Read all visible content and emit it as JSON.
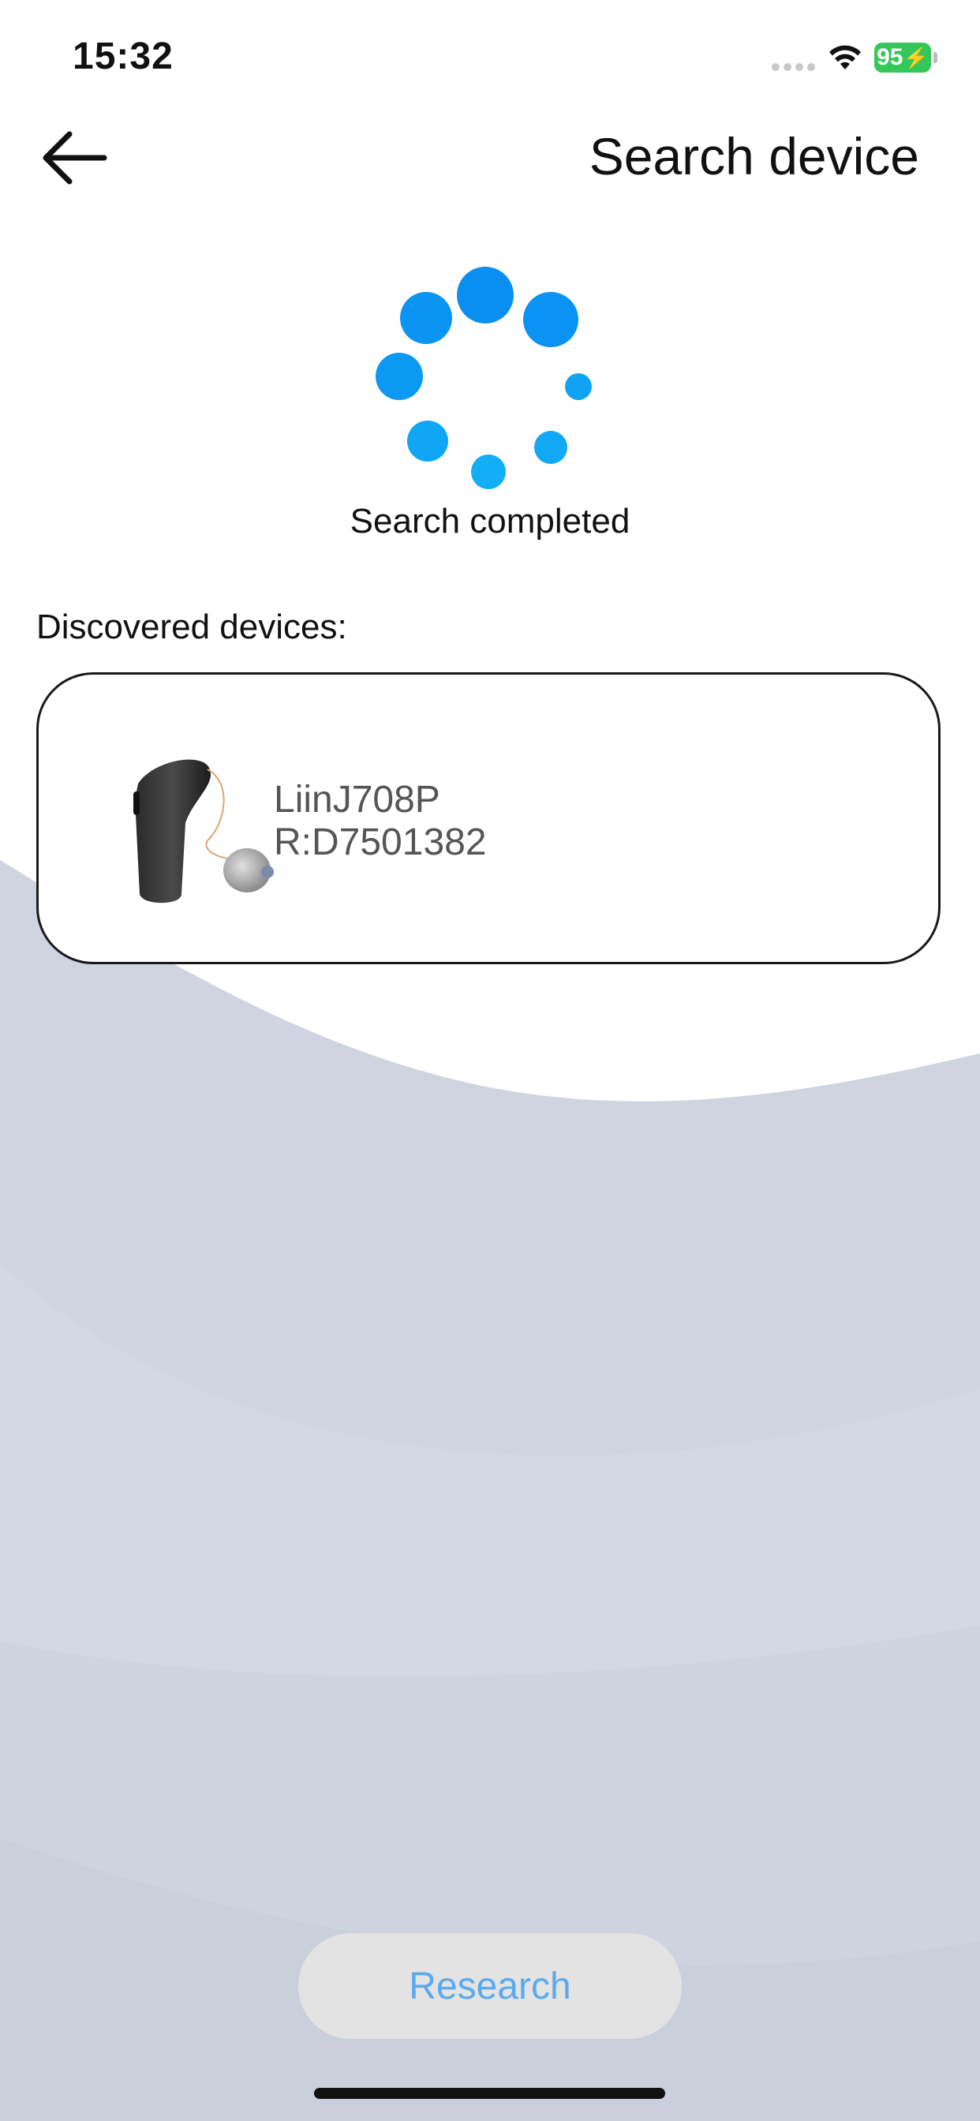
{
  "status_bar": {
    "time": "15:32",
    "battery": "95"
  },
  "header": {
    "title": "Search device",
    "back_icon": "arrow-left-icon"
  },
  "search": {
    "status": "Search completed",
    "spinner_icon": "loading-spinner-icon"
  },
  "devices": {
    "label": "Discovered devices:",
    "items": [
      {
        "name": "LiinJ708P",
        "serial": "R:D7501382",
        "icon": "hearing-aid-icon"
      }
    ]
  },
  "actions": {
    "research_label": "Research"
  },
  "colors": {
    "accent": "#0a9bf5",
    "button_text": "#5aaaf0",
    "button_bg": "#e3e3e3",
    "background_wave": "#cdd2df",
    "battery": "#34c759"
  }
}
